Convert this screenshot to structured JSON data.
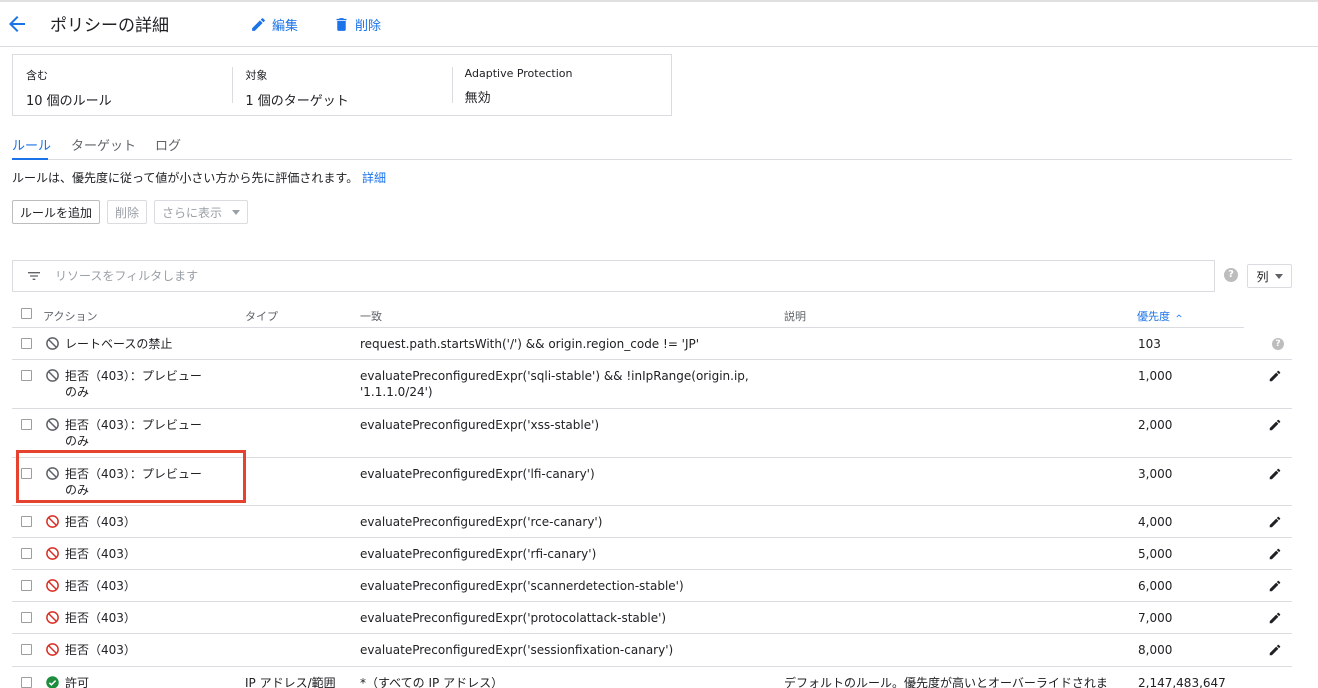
{
  "header": {
    "title": "ポリシーの詳細",
    "edit_label": "編集",
    "delete_label": "削除"
  },
  "summary": {
    "includes_label": "含む",
    "includes_value": "10 個のルール",
    "targets_label": "対象",
    "targets_value": "1 個のターゲット",
    "adaptive_label": "Adaptive Protection",
    "adaptive_value": "無効"
  },
  "tabs": [
    {
      "label": "ルール",
      "active": true
    },
    {
      "label": "ターゲット",
      "active": false
    },
    {
      "label": "ログ",
      "active": false
    }
  ],
  "description": {
    "text": "ルールは、優先度に従って値が小さい方から先に評価されます。",
    "link": "詳細"
  },
  "buttons": {
    "add_rule": "ルールを追加",
    "delete": "削除",
    "show_more": "さらに表示"
  },
  "filter": {
    "placeholder": "リソースをフィルタします",
    "columns_label": "列"
  },
  "table": {
    "columns": {
      "action": "アクション",
      "type": "タイプ",
      "match": "一致",
      "description": "説明",
      "priority": "優先度"
    },
    "rows": [
      {
        "action": "レートベースの禁止",
        "icon": "block-gray",
        "type": "",
        "match": "request.path.startsWith('/') && origin.region_code != 'JP'",
        "description": "",
        "priority": "103",
        "end": "help"
      },
      {
        "action": "拒否（403）：プレビューのみ",
        "icon": "block-gray",
        "type": "",
        "match": "evaluatePreconfiguredExpr('sqli-stable') && !inIpRange(origin.ip, '1.1.1.0/24')",
        "description": "",
        "priority": "1,000",
        "end": "edit"
      },
      {
        "action": "拒否（403）：プレビューのみ",
        "icon": "block-gray",
        "type": "",
        "match": "evaluatePreconfiguredExpr('xss-stable')",
        "description": "",
        "priority": "2,000",
        "end": "edit"
      },
      {
        "action": "拒否（403）：プレビューのみ",
        "icon": "block-gray",
        "type": "",
        "match": "evaluatePreconfiguredExpr('lfi-canary')",
        "description": "",
        "priority": "3,000",
        "end": "edit"
      },
      {
        "action": "拒否（403）",
        "icon": "block-red",
        "type": "",
        "match": "evaluatePreconfiguredExpr('rce-canary')",
        "description": "",
        "priority": "4,000",
        "end": "edit"
      },
      {
        "action": "拒否（403）",
        "icon": "block-red",
        "type": "",
        "match": "evaluatePreconfiguredExpr('rfi-canary')",
        "description": "",
        "priority": "5,000",
        "end": "edit"
      },
      {
        "action": "拒否（403）",
        "icon": "block-red",
        "type": "",
        "match": "evaluatePreconfiguredExpr('scannerdetection-stable')",
        "description": "",
        "priority": "6,000",
        "end": "edit"
      },
      {
        "action": "拒否（403）",
        "icon": "block-red",
        "type": "",
        "match": "evaluatePreconfiguredExpr('protocolattack-stable')",
        "description": "",
        "priority": "7,000",
        "end": "edit"
      },
      {
        "action": "拒否（403）",
        "icon": "block-red",
        "type": "",
        "match": "evaluatePreconfiguredExpr('sessionfixation-canary')",
        "description": "",
        "priority": "8,000",
        "end": "edit"
      },
      {
        "action": "許可",
        "icon": "check-green",
        "type": "IP アドレス/範囲",
        "match": "*（すべての IP アドレス）",
        "description": "デフォルトのルール。優先度が高いとオーバーライドされま",
        "priority": "2,147,483,647",
        "end": "none"
      }
    ]
  },
  "colors": {
    "accent": "#1a73e8",
    "deny_red": "#d93025",
    "allow_green": "#1e8e3e",
    "highlight": "#e5432f"
  }
}
